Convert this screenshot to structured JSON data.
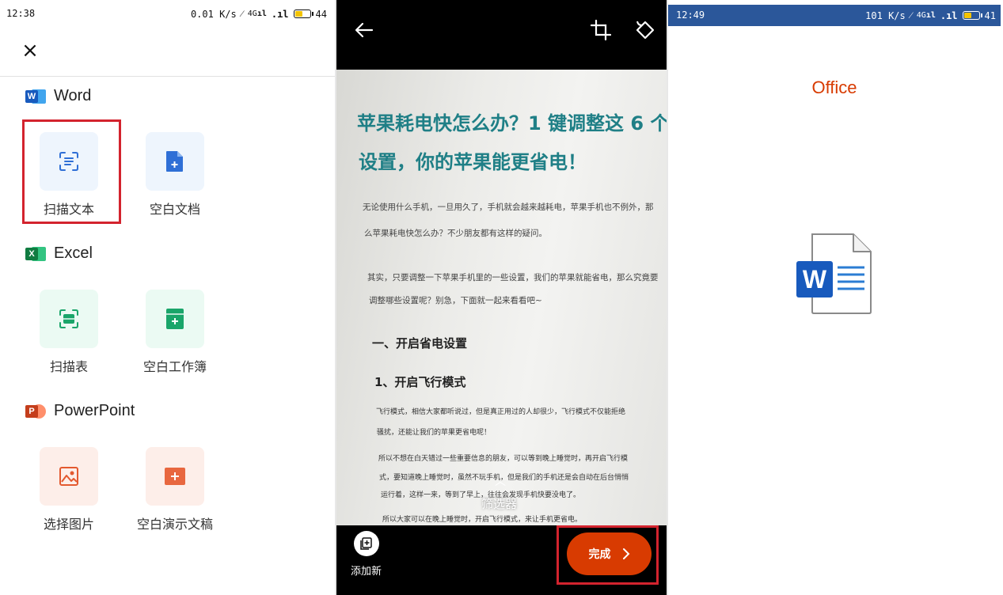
{
  "panel1": {
    "status": {
      "time": "12:38",
      "speed": "0.01 K/s",
      "signal": "4G",
      "battery": "44"
    },
    "close_label": "×",
    "sections": [
      {
        "name": "Word",
        "logo_letter": "W",
        "color": "#185abd",
        "tiles": [
          {
            "label": "扫描文本",
            "icon": "scan-text-icon"
          },
          {
            "label": "空白文档",
            "icon": "blank-document-icon"
          }
        ]
      },
      {
        "name": "Excel",
        "logo_letter": "X",
        "color": "#107c41",
        "tiles": [
          {
            "label": "扫描表",
            "icon": "scan-table-icon"
          },
          {
            "label": "空白工作簿",
            "icon": "blank-workbook-icon"
          }
        ]
      },
      {
        "name": "PowerPoint",
        "logo_letter": "P",
        "color": "#c43e1c",
        "tiles": [
          {
            "label": "选择图片",
            "icon": "choose-image-icon"
          },
          {
            "label": "空白演示文稿",
            "icon": "blank-presentation-icon"
          }
        ]
      }
    ]
  },
  "panel2": {
    "document": {
      "title_line1": "苹果耗电快怎么办？1 键调整这 6 个",
      "title_line2": "设置，你的苹果能更省电！",
      "para1_line1": "无论使用什么手机，一旦用久了，手机就会越来越耗电，苹果手机也不例外，那",
      "para1_line2": "么苹果耗电快怎么办？不少朋友都有这样的疑问。",
      "para2_line1": "其实，只要调整一下苹果手机里的一些设置，我们的苹果就能省电，那么究竟要",
      "para2_line2": "调整哪些设置呢？别急，下面就一起来看看吧~",
      "heading1": "一、开启省电设置",
      "heading2": "1、开启飞行模式",
      "para3_line1": "飞行模式，相信大家都听说过，但是真正用过的人却很少，飞行模式不仅能拒绝",
      "para3_line2": "骚扰，还能让我们的苹果更省电呢！",
      "para4_line1": "所以不想在白天错过一些重要信息的朋友，可以等到晚上睡觉时，再开启飞行模",
      "para4_line2": "式，要知道晚上睡觉时，虽然不玩手机，但是我们的手机还是会自动在后台悄悄",
      "para4_line3": "运行着，这样一来，等到了早上，往往会发现手机快要没电了。",
      "para4_line4": "所以大家可以在晚上睡觉时，开启飞行模式，来让手机更省电。"
    },
    "filter_label": "筛选器",
    "add_new_label": "添加新",
    "done_label": "完成"
  },
  "panel3": {
    "status": {
      "time": "12:49",
      "speed": "101 K/s",
      "signal": "4G",
      "battery": "41"
    },
    "title": "Office",
    "doc_letter": "W"
  },
  "colors": {
    "word_blue": "#185abd",
    "excel_green": "#107c41",
    "ppt_orange": "#c43e1c",
    "office_orange": "#d83b01",
    "highlight_red": "#d3232e",
    "status_blue": "#2b579a"
  }
}
